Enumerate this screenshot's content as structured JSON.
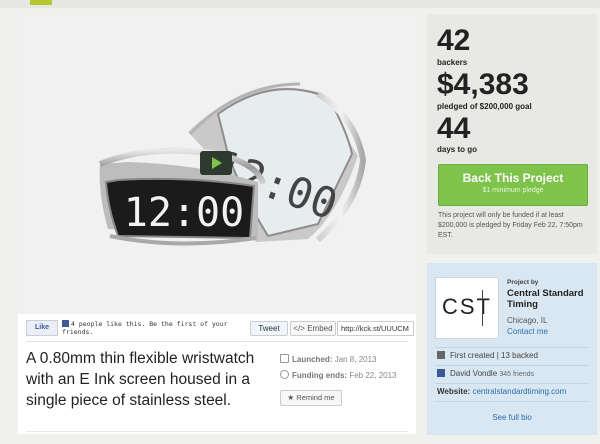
{
  "video": {
    "watch_face_front": "12:00",
    "watch_face_back": "12:00"
  },
  "social": {
    "like_label": "Like",
    "fb_text": "4 people like this. Be the first of your friends.",
    "tweet_label": "Tweet",
    "embed_label": "Embed",
    "short_url": "http://kck.st/UUUCM"
  },
  "project": {
    "blurb": "A 0.80mm thin flexible wristwatch with an E Ink screen housed in a single piece of stainless steel.",
    "launched_label": "Launched:",
    "launched_value": "Jan 8, 2013",
    "funding_label": "Funding ends:",
    "funding_value": "Feb 22, 2013",
    "remind_label": "Remind me"
  },
  "stats": {
    "backers_num": "42",
    "backers_label": "backers",
    "pledged_num": "$4,383",
    "pledged_label": "pledged of $200,000 goal",
    "days_num": "44",
    "days_label": "days to go",
    "back_title": "Back This Project",
    "back_sub": "$1 minimum pledge",
    "fund_note": "This project will only be funded if at least $200,000 is pledged by Friday Feb 22, 7:50pm EST."
  },
  "creator": {
    "logo_text": "CST",
    "project_by": "Project by",
    "name": "Central Standard Timing",
    "location": "Chicago, IL",
    "contact": "Contact me",
    "first_created": "First created",
    "backed": "13 backed",
    "fb_name": "David Vondle",
    "fb_friends": "345 friends",
    "website_label": "Website:",
    "website_url": "centralstandardtiming.com",
    "full_bio": "See full bio"
  },
  "colors": {
    "accent_green": "#7ec34a",
    "link_blue": "#2a6fb0",
    "creator_bg": "#d9e7f2",
    "stats_bg": "#e8e8e5"
  }
}
